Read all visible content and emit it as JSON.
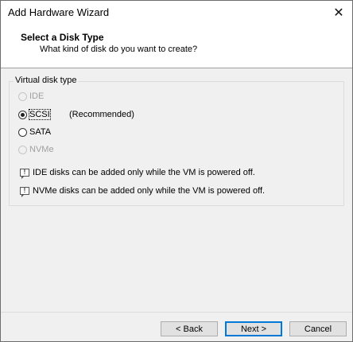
{
  "window": {
    "title": "Add Hardware Wizard",
    "close_symbol": "✕"
  },
  "header": {
    "title": "Select a Disk Type",
    "subtitle": "What kind of disk do you want to create?"
  },
  "group": {
    "legend": "Virtual disk type",
    "options": [
      {
        "label": "IDE",
        "checked": false,
        "enabled": false
      },
      {
        "label": "SCSI",
        "checked": true,
        "enabled": true,
        "note": "(Recommended)"
      },
      {
        "label": "SATA",
        "checked": false,
        "enabled": true
      },
      {
        "label": "NVMe",
        "checked": false,
        "enabled": false
      }
    ],
    "notes": [
      {
        "icon": "info-icon",
        "text": "IDE disks can be added only while the VM is powered off."
      },
      {
        "icon": "info-icon",
        "text": "NVMe disks can be added only while the VM is powered off."
      }
    ]
  },
  "buttons": {
    "back": "< Back",
    "next": "Next >",
    "cancel": "Cancel"
  },
  "colors": {
    "default_button_border": "#0078d7",
    "dialog_background": "#f0f0f0"
  }
}
